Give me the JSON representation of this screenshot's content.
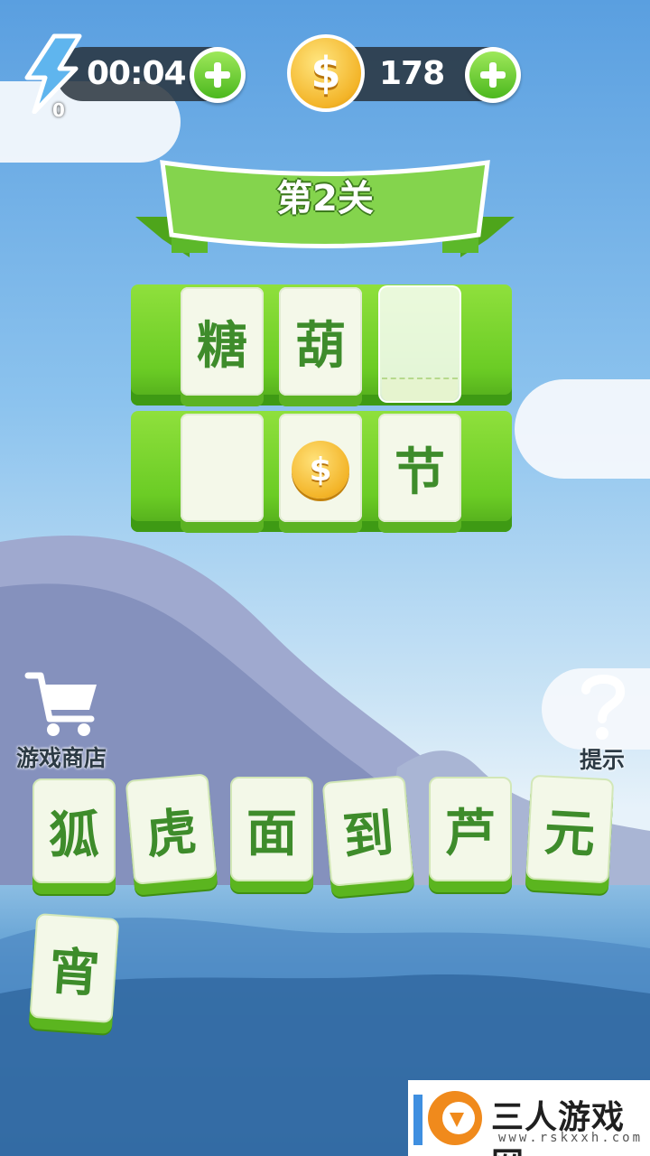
{
  "hud": {
    "timer": "00:04",
    "energy_count": "0",
    "coins": "178"
  },
  "level": {
    "title": "第2关"
  },
  "board": {
    "row1": [
      {
        "char": "糖",
        "state": "filled"
      },
      {
        "char": "葫",
        "state": "filled"
      },
      {
        "char": "",
        "state": "selected-empty"
      }
    ],
    "row2": [
      {
        "char": "",
        "state": "empty"
      },
      {
        "char": "",
        "state": "coin"
      },
      {
        "char": "节",
        "state": "filled"
      }
    ],
    "coin_symbol": "$"
  },
  "pool": [
    "狐",
    "虎",
    "面",
    "到",
    "芦",
    "元",
    "宵"
  ],
  "shop": {
    "label": "游戏商店"
  },
  "hint": {
    "label": "提示"
  },
  "watermark": {
    "text": "三人游戏网",
    "url": "www.rskxxh.com"
  },
  "colors": {
    "tile_green": "#6bcc25",
    "char_green": "#3e8c2b",
    "coin_gold": "#f3b428",
    "hud_dark": "#28323c"
  }
}
